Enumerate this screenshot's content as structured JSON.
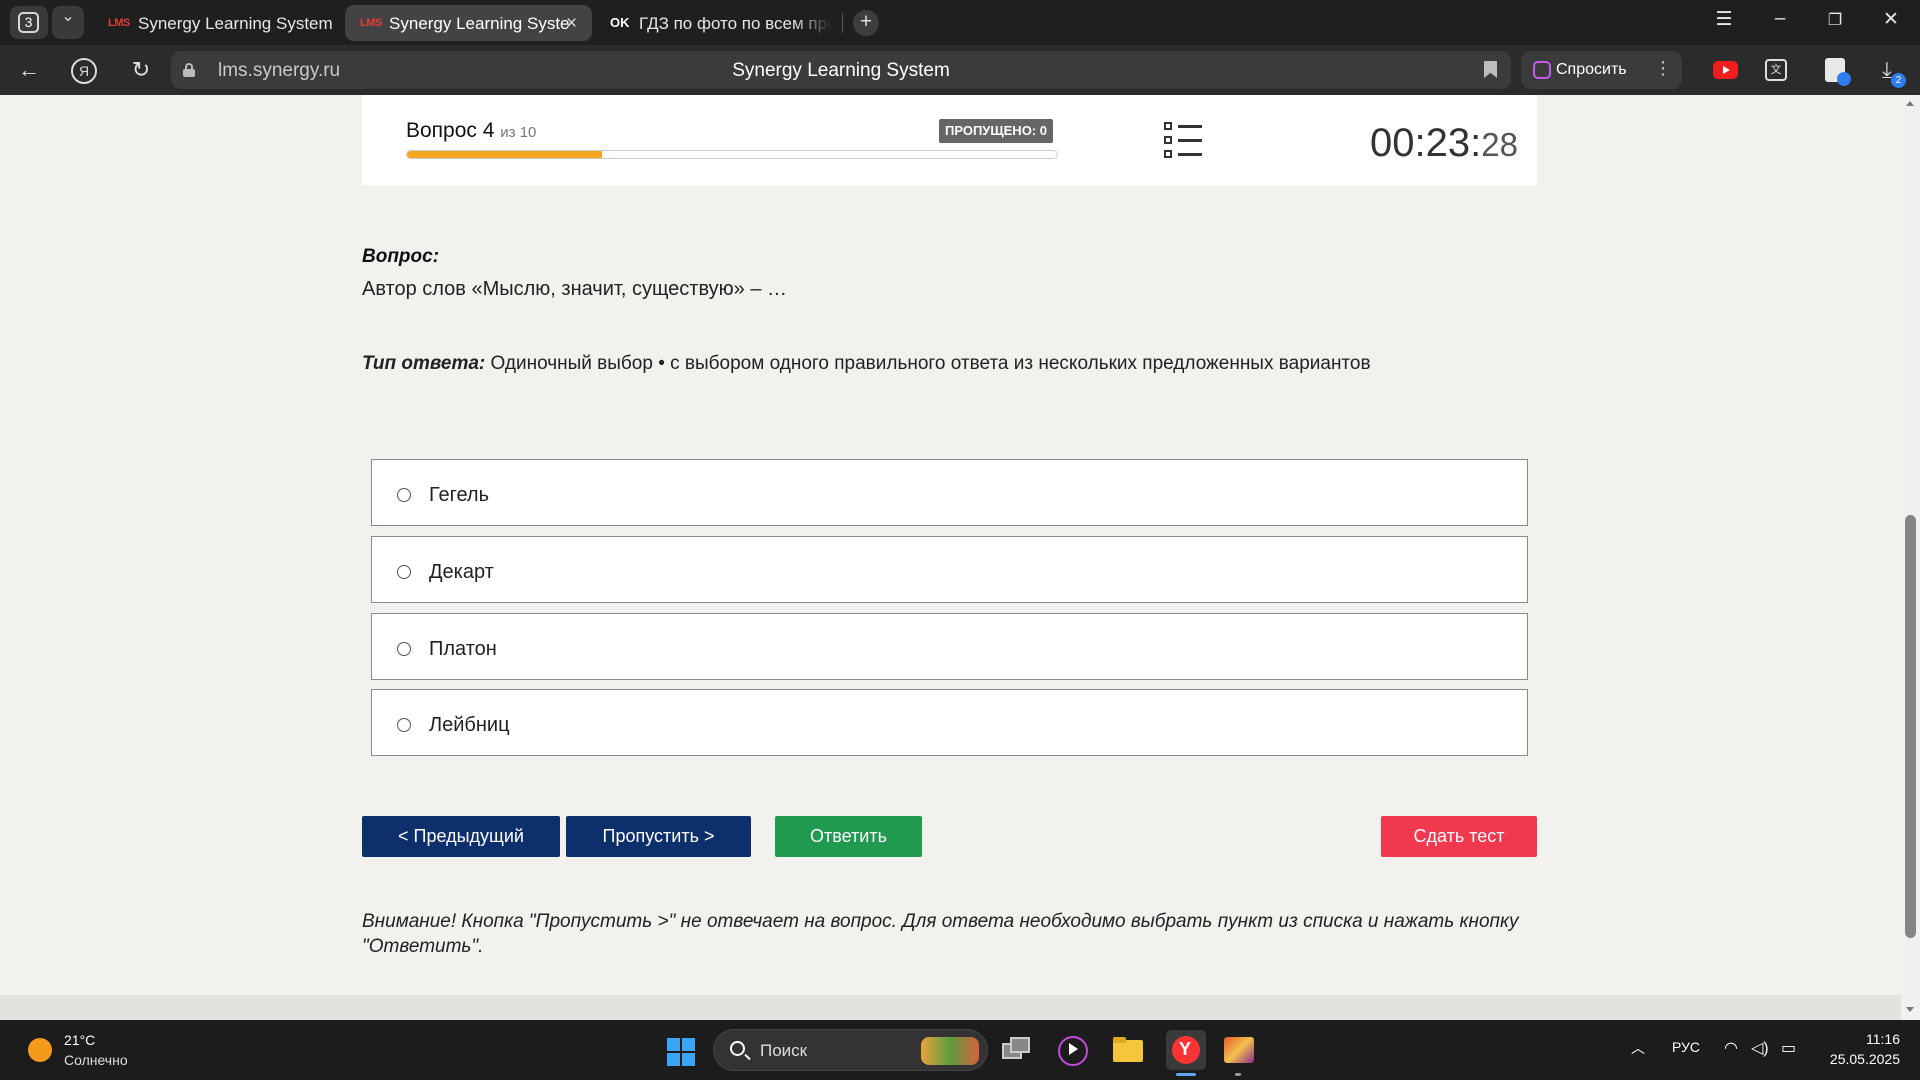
{
  "browser": {
    "tab_count": "3",
    "tabs": [
      {
        "label": "Synergy Learning System",
        "logo": "LMS"
      },
      {
        "label": "Synergy Learning Syste",
        "logo": "LMS"
      },
      {
        "label": "ГДЗ по фото по всем пре",
        "logo": "OK"
      }
    ],
    "url": "lms.synergy.ru",
    "page_title": "Synergy Learning System",
    "ask_label": "Спросить",
    "downloads_badge": "2"
  },
  "test": {
    "question_word": "Вопрос 4",
    "question_of": "из 10",
    "progress_fraction": 0.3,
    "skipped_badge": "ПРОПУЩЕНО: 0",
    "timer_main": "00:23:",
    "timer_seconds": "28",
    "question_label": "Вопрос:",
    "question_text": "Автор слов «Мыслю, значит, существую» – …",
    "answer_type_label": "Тип ответа:",
    "answer_type_value": " Одиночный выбор • с выбором одного правильного ответа из нескольких предложенных вариантов",
    "options": [
      "Гегель",
      "Декарт",
      "Платон",
      "Лейбниц"
    ],
    "buttons": {
      "prev": "< Предыдущий",
      "skip": "Пропустить >",
      "answer": "Ответить",
      "submit": "Сдать тест"
    },
    "warning": "Внимание! Кнопка \"Пропустить >\" не отвечает на вопрос. Для ответа необходимо выбрать пункт из списка и нажать кнопку \"Ответить\"."
  },
  "taskbar": {
    "weather_temp": "21°C",
    "weather_desc": "Солнечно",
    "search_placeholder": "Поиск",
    "lang": "РУС",
    "time": "11:16",
    "date": "25.05.2025"
  },
  "colors": {
    "progress": "#f5a623",
    "nav_button": "#0d2f6b",
    "answer_button": "#1f9a4f",
    "submit_button": "#f0384f"
  }
}
